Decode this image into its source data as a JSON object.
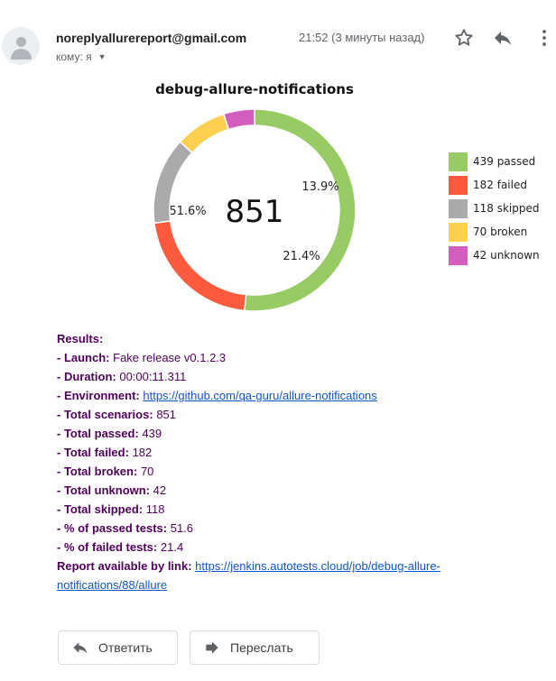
{
  "header": {
    "sender": "noreplyallurereport@gmail.com",
    "to_label": "кому: я",
    "time": "21:52 (3 минуты назад)"
  },
  "chart_data": {
    "type": "pie",
    "title": "debug-allure-notifications",
    "total_label": "851",
    "slices": [
      {
        "name": "439 passed",
        "value": 439,
        "color": "#97cc64",
        "pct_label": "51.6%"
      },
      {
        "name": "182 failed",
        "value": 182,
        "color": "#fd5a3e",
        "pct_label": "21.4%"
      },
      {
        "name": "118 skipped",
        "value": 118,
        "color": "#aaaaaa",
        "pct_label": "13.9%"
      },
      {
        "name": "70 broken",
        "value": 70,
        "color": "#ffd050",
        "pct_label": ""
      },
      {
        "name": "42 unknown",
        "value": 42,
        "color": "#d35ebe",
        "pct_label": ""
      }
    ]
  },
  "results": {
    "heading": "Results:",
    "launch_label": "- Launch:",
    "launch_value": "Fake release v0.1.2.3",
    "duration_label": "- Duration:",
    "duration_value": "00:00:11.311",
    "environment_label": "- Environment:",
    "environment_link": "https://github.com/qa-guru/allure-notifications",
    "scenarios_label": "- Total scenarios:",
    "scenarios_value": "851",
    "passed_label": "- Total passed:",
    "passed_value": "439",
    "failed_label": "- Total failed:",
    "failed_value": "182",
    "broken_label": "- Total broken:",
    "broken_value": "70",
    "unknown_label": "- Total unknown:",
    "unknown_value": "42",
    "skipped_label": "- Total skipped:",
    "skipped_value": "118",
    "pct_passed_label": "- % of passed tests:",
    "pct_passed_value": "51.6",
    "pct_failed_label": "- % of failed tests:",
    "pct_failed_value": "21.4",
    "report_label": "Report available by link:",
    "report_link_1": "https://jenkins.autotests.cloud/job/debug-allure-",
    "report_link_2": "notifications/88/allure"
  },
  "actions": {
    "reply_label": "Ответить",
    "forward_label": "Переслать"
  },
  "icons": {
    "avatar": "person-icon",
    "star": "star-icon",
    "reply": "reply-icon",
    "more": "more-vert-icon",
    "forward": "forward-icon"
  }
}
